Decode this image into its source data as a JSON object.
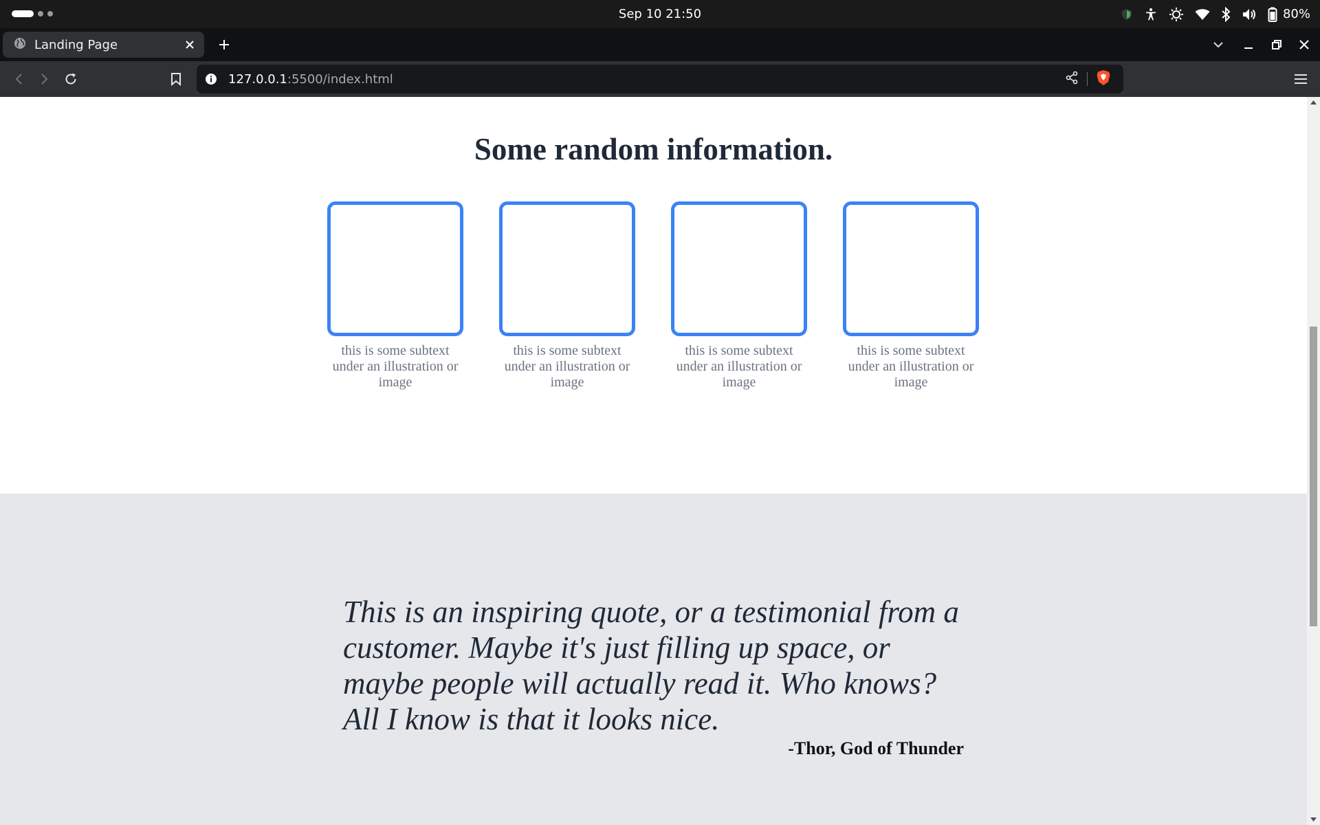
{
  "system_bar": {
    "clock": "Sep 10  21:50",
    "battery_percent": "80%",
    "icons": [
      "shield-icon",
      "accessibility-icon",
      "brightness-icon",
      "wifi-icon",
      "bluetooth-icon",
      "volume-icon",
      "battery-icon"
    ]
  },
  "browser": {
    "tab": {
      "title": "Landing Page",
      "favicon": "globe-icon"
    },
    "url": {
      "host": "127.0.0.1",
      "path": ":5500/index.html"
    },
    "accent": "#fb542b"
  },
  "page": {
    "info": {
      "heading": "Some random information.",
      "cards": [
        {
          "caption": "this is some subtext under an illustration or image"
        },
        {
          "caption": "this is some subtext under an illustration or image"
        },
        {
          "caption": "this is some subtext under an illustration or image"
        },
        {
          "caption": "this is some subtext under an illustration or image"
        }
      ],
      "card_border_color": "#3b82f6"
    },
    "quote": {
      "text": "This is an inspiring quote, or a testimonial from a customer. Maybe it's just filling up space, or maybe people will actually read it. Who knows? All I know is that it looks nice.",
      "author": "-Thor, God of Thunder",
      "background": "#e5e7eb"
    }
  },
  "scroll": {
    "position_fraction": 0.35
  }
}
